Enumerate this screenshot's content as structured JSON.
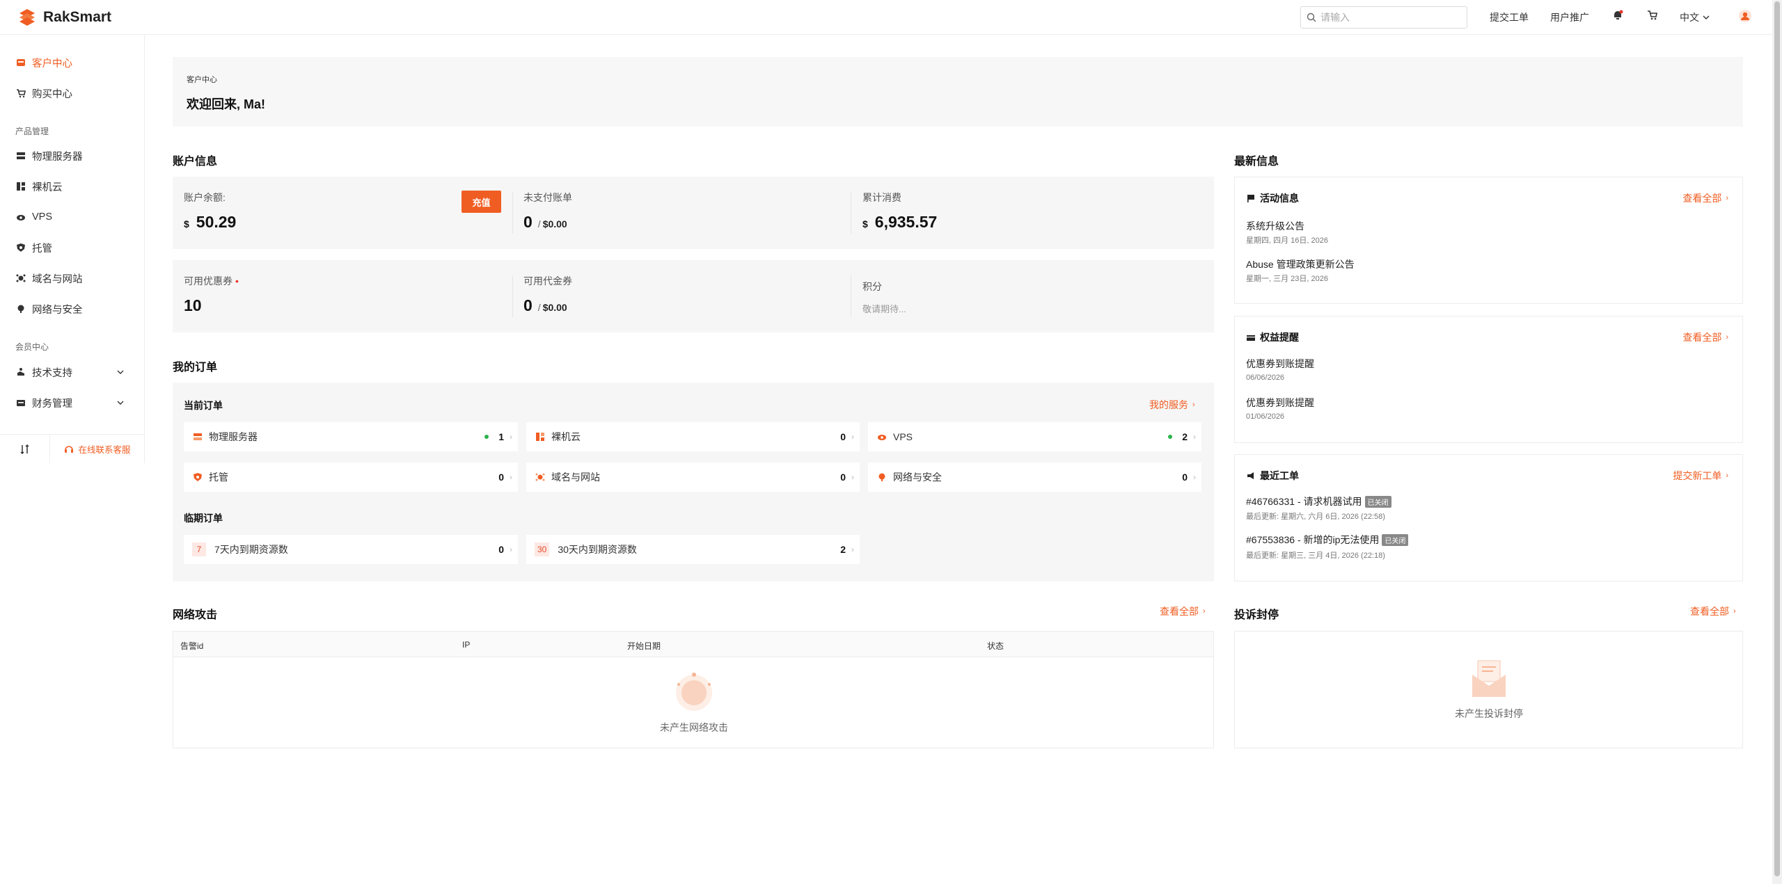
{
  "brand": {
    "name": "RakSmart",
    "color": "#f05d22"
  },
  "header": {
    "search_placeholder": "请输入",
    "submit_ticket": "提交工单",
    "affiliate": "用户推广",
    "language": "中文",
    "icons": [
      "search-icon",
      "bell-icon",
      "cart-icon",
      "user-avatar-icon"
    ]
  },
  "sidebar": {
    "items": [
      {
        "label": "客户中心",
        "icon": "home-icon",
        "active": true
      },
      {
        "label": "购买中心",
        "icon": "cart-icon"
      }
    ],
    "group_products": "产品管理",
    "product_items": [
      {
        "label": "物理服务器",
        "icon": "server-icon"
      },
      {
        "label": "裸机云",
        "icon": "baremetal-icon"
      },
      {
        "label": "VPS",
        "icon": "vps-icon"
      },
      {
        "label": "托管",
        "icon": "shield-icon"
      },
      {
        "label": "域名与网站",
        "icon": "globe-icon"
      },
      {
        "label": "网络与安全",
        "icon": "network-icon"
      }
    ],
    "group_member": "会员中心",
    "member_items": [
      {
        "label": "技术支持",
        "icon": "support-icon"
      },
      {
        "label": "财务管理",
        "icon": "wallet-icon"
      }
    ],
    "online_service": "在线联系客服"
  },
  "welcome": {
    "breadcrumb": "客户中心",
    "greeting": "欢迎回来, Ma!"
  },
  "account": {
    "title": "账户信息",
    "balance_label": "账户余额:",
    "currency": "$",
    "balance": "50.29",
    "recharge": "充值",
    "unpaid_label": "未支付账单",
    "unpaid_count": "0",
    "unpaid_amount": "$0.00",
    "total_label": "累计消费",
    "total": "6,935.57",
    "coupon_label": "可用优惠券",
    "coupon_count": "10",
    "voucher_label": "可用代金券",
    "voucher_count": "0",
    "voucher_amount": "$0.00",
    "points_label": "积分",
    "points_value": "敬请期待..."
  },
  "orders": {
    "title": "我的订单",
    "current_title": "当前订单",
    "my_services": "我的服务",
    "items": [
      {
        "label": "物理服务器",
        "count": "1",
        "active": true
      },
      {
        "label": "裸机云",
        "count": "0"
      },
      {
        "label": "VPS",
        "count": "2",
        "active": true
      },
      {
        "label": "托管",
        "count": "0"
      },
      {
        "label": "域名与网站",
        "count": "0"
      },
      {
        "label": "网络与安全",
        "count": "0"
      }
    ],
    "expiring_title": "临期订单",
    "expiring": [
      {
        "badge": "7",
        "label": "7天内到期资源数",
        "count": "0"
      },
      {
        "badge": "30",
        "label": "30天内到期资源数",
        "count": "2"
      }
    ]
  },
  "attacks": {
    "title": "网络攻击",
    "view_all": "查看全部",
    "columns": [
      "告警id",
      "IP",
      "开始日期",
      "状态"
    ],
    "empty": "未产生网络攻击"
  },
  "news": {
    "title": "最新信息",
    "activity": {
      "title": "活动信息",
      "view_all": "查看全部",
      "items": [
        {
          "title": "系统升级公告",
          "date": "星期四, 四月 16日, 2026"
        },
        {
          "title": "Abuse 管理政策更新公告",
          "date": "星期一, 三月 23日, 2026"
        }
      ]
    },
    "benefits": {
      "title": "权益提醒",
      "view_all": "查看全部",
      "items": [
        {
          "title": "优惠券到账提醒",
          "date": "06/06/2026"
        },
        {
          "title": "优惠券到账提醒",
          "date": "01/06/2026"
        }
      ]
    },
    "tickets": {
      "title": "最近工单",
      "new_ticket": "提交新工单",
      "items": [
        {
          "title": "#46766331 - 请求机器试用",
          "status": "已关闭",
          "date": "最后更新: 星期六, 六月 6日, 2026 (22:58)"
        },
        {
          "title": "#67553836 - 新增的ip无法使用",
          "status": "已关闭",
          "date": "最后更新: 星期三, 三月 4日, 2026 (22:18)"
        }
      ]
    }
  },
  "complaints": {
    "title": "投诉封停",
    "view_all": "查看全部",
    "empty": "未产生投诉封停"
  }
}
